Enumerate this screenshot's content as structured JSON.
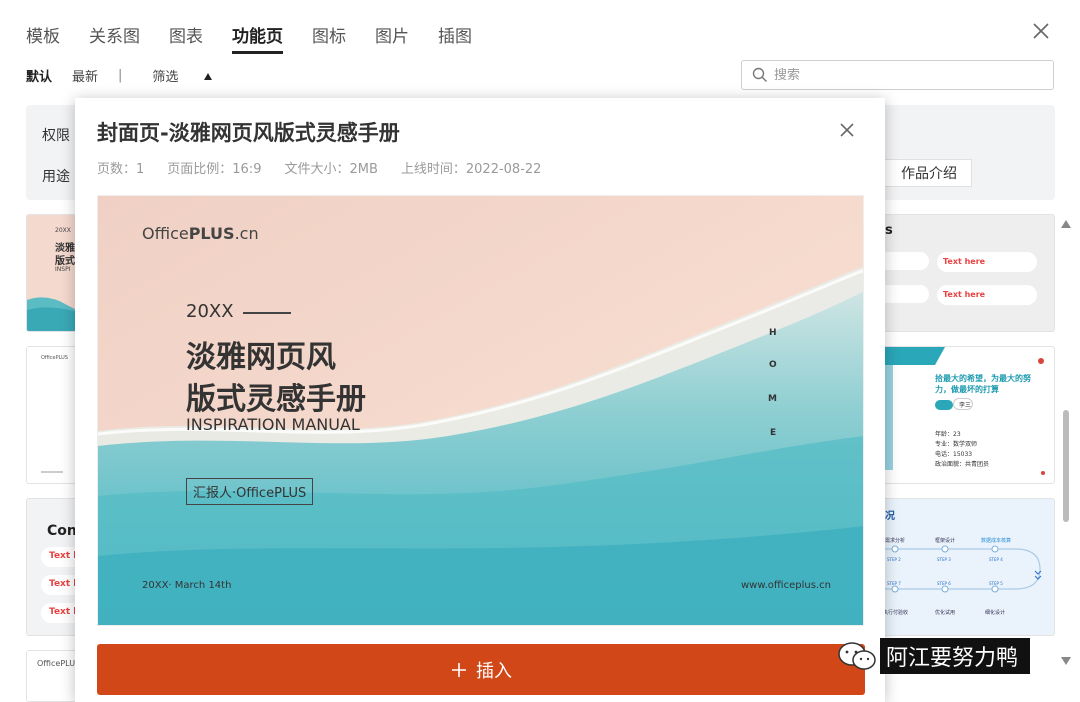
{
  "tabs": [
    {
      "label": "模板"
    },
    {
      "label": "关系图"
    },
    {
      "label": "图表"
    },
    {
      "label": "功能页",
      "active": true
    },
    {
      "label": "图标"
    },
    {
      "label": "图片"
    },
    {
      "label": "插图"
    }
  ],
  "subbar": {
    "default": "默认",
    "latest": "最新",
    "separator": "|",
    "filter": "筛选"
  },
  "search": {
    "placeholder": "搜索"
  },
  "filter_panel": {
    "permission_label": "权限",
    "usage_label": "用途",
    "usage_chip": "作品介绍"
  },
  "background_cards": {
    "left_1": {
      "small": "20XX",
      "title1": "淡雅",
      "title2": "版式",
      "sub": "INSPI"
    },
    "left_2": {
      "logo": "OfficePLUS"
    },
    "left_3": {
      "title": "Con",
      "items": [
        "Text h",
        "Text h",
        "Text h"
      ]
    },
    "left_4": {
      "logo": "OfficePLUS"
    },
    "right_1": {
      "title": "s",
      "items": [
        "Text here",
        "Text here"
      ]
    },
    "right_2": {
      "heading": "拾最大的希望，为最大的努力，做最坏的打算",
      "name": "李三",
      "lines": [
        "年龄：23",
        "专业：数学双师",
        "电话：15033",
        "政治面貌：共青团员"
      ]
    },
    "right_3": {
      "title": "情况",
      "steps": [
        "需求分析",
        "框架设计",
        "数据成本核算",
        "STEP 2",
        "STEP 3",
        "STEP 4",
        "STEP 7",
        "STEP 6",
        "STEP 5",
        "执行付验收",
        "优化试用",
        "细化设计"
      ]
    }
  },
  "modal": {
    "title": "封面页-淡雅网页风版式灵感手册",
    "meta": {
      "pages": "页数：1",
      "ratio": "页面比例：16:9",
      "size": "文件大小：2MB",
      "date": "上线时间：2022-08-22"
    },
    "preview": {
      "logo_a": "Office",
      "logo_b": "PLUS",
      "logo_c": ".cn",
      "year": "20XX",
      "title_line1": "淡雅网页风",
      "title_line2": "版式灵感手册",
      "subtitle": "INSPIRATION MANUAL",
      "reporter": "汇报人·OfficePLUS",
      "date": "20XX· March 14th",
      "website": "www.officeplus.cn",
      "vertical": [
        "H",
        "O",
        "M",
        "E"
      ]
    },
    "insert_label": "插入"
  },
  "watermark": {
    "text": "阿江要努力鸭"
  },
  "colors": {
    "accent": "#d24718",
    "panel": "#f2f3f5"
  }
}
